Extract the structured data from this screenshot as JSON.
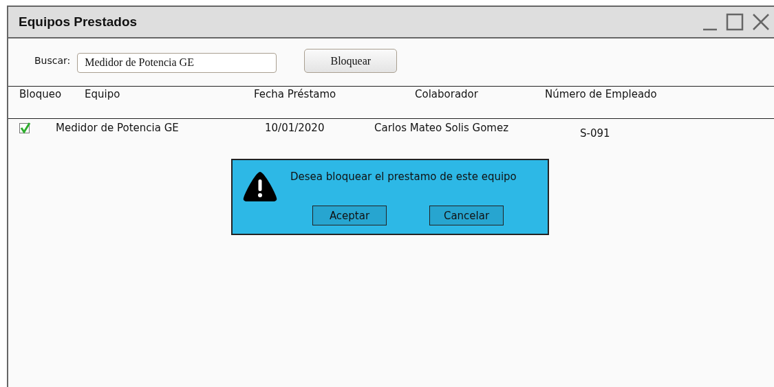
{
  "window": {
    "title": "Equipos Prestados"
  },
  "search": {
    "label": "Buscar:",
    "value": "Medidor de Potencia GE"
  },
  "block_button": "Bloquear",
  "table": {
    "columns": [
      "Bloqueo",
      "Equipo",
      "Fecha Préstamo",
      "Colaborador",
      "Número de Empleado"
    ],
    "rows": [
      {
        "blocked": true,
        "equipo": "Medidor de Potencia GE",
        "fecha": "10/01/2020",
        "colaborador": "Carlos Mateo Solis Gomez",
        "numero": "S-091"
      }
    ]
  },
  "dialog": {
    "message": "Desea bloquear el prestamo de este equipo",
    "buttons": [
      "Aceptar",
      "Cancelar"
    ]
  }
}
